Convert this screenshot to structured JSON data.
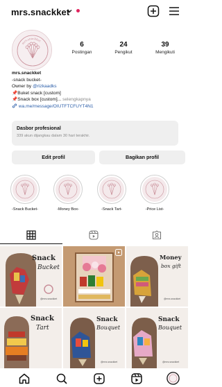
{
  "header": {
    "username": "mrs.snackket",
    "notification_color": "#e0245e"
  },
  "stats": [
    {
      "value": "6",
      "label": "Postingan"
    },
    {
      "value": "24",
      "label": "Pengikut"
    },
    {
      "value": "39",
      "label": "Mengikuti"
    }
  ],
  "bio": {
    "name": "mrs.snackket",
    "tagline": "-snack bucket-",
    "owner_prefix": "Owner by ",
    "owner_handle": "@rizkaadks",
    "line1": "📌Buket snack [custom]",
    "line2": "📌Snack box [custom]...",
    "more": " selengkapnya",
    "link": "wa.me/message/OIUTFTCFUYT4N1"
  },
  "dashboard": {
    "title": "Dasbor profesional",
    "subtitle": "339 akun dijangkau dalam 30 hari terakhir."
  },
  "buttons": {
    "edit": "Edit profil",
    "share": "Bagikan profil"
  },
  "highlights": [
    {
      "label": "-Snack Bucket-"
    },
    {
      "label": "-Money Box-"
    },
    {
      "label": "-Snack Tart-"
    },
    {
      "label": "-Price List-"
    }
  ],
  "tabs": [
    "grid-icon",
    "reels-icon",
    "tagged-icon"
  ],
  "grid": [
    {
      "title": "Snack",
      "script": "Bucket",
      "tag": "@mrs.snackket"
    },
    {
      "title": "",
      "script": "",
      "tag": ""
    },
    {
      "title": "Money",
      "script": "box gift",
      "tag": "@mrs.snackket"
    },
    {
      "title": "Snack",
      "script": "Tart",
      "tag": ""
    },
    {
      "title": "Snack",
      "script": "Bouquet",
      "tag": "@mrs.snackket"
    },
    {
      "title": "Snack",
      "script": "Bouquet",
      "tag": "@mrs.snackket"
    }
  ],
  "colors": {
    "accent_pink": "#e0245e",
    "link_blue": "#2a5da8",
    "logo_rose": "#c98f99"
  },
  "bottom_nav": [
    "home-icon",
    "search-icon",
    "create-icon",
    "reels-icon",
    "profile-avatar"
  ]
}
